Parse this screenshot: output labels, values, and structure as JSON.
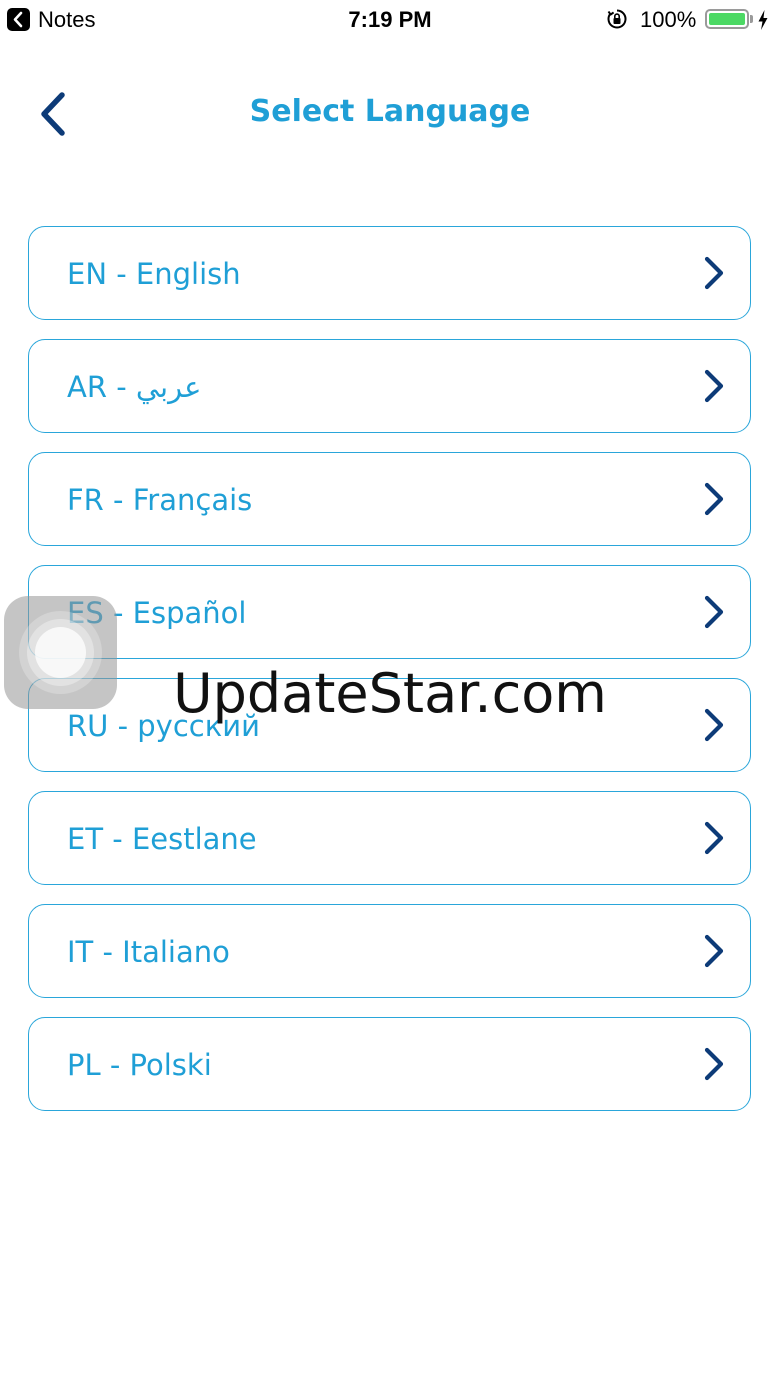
{
  "status_bar": {
    "app_name": "Notes",
    "time": "7:19 PM",
    "battery_percent": "100%",
    "battery_level": 1.0,
    "battery_color": "#4cd964"
  },
  "header": {
    "title": "Select Language",
    "back_icon": "chevron-left-icon"
  },
  "languages": [
    {
      "label": "EN - English"
    },
    {
      "label": "AR - عربي"
    },
    {
      "label": "FR - Français"
    },
    {
      "label": "ES - Español"
    },
    {
      "label": "RU - русский"
    },
    {
      "label": "ET - Eestlane"
    },
    {
      "label": "IT - Italiano"
    },
    {
      "label": "PL - Polski"
    }
  ],
  "colors": {
    "accent": "#1f9fd6",
    "chevron": "#0d3b78",
    "border": "#2aa6da"
  },
  "watermark": {
    "text": "UpdateStar.com"
  }
}
